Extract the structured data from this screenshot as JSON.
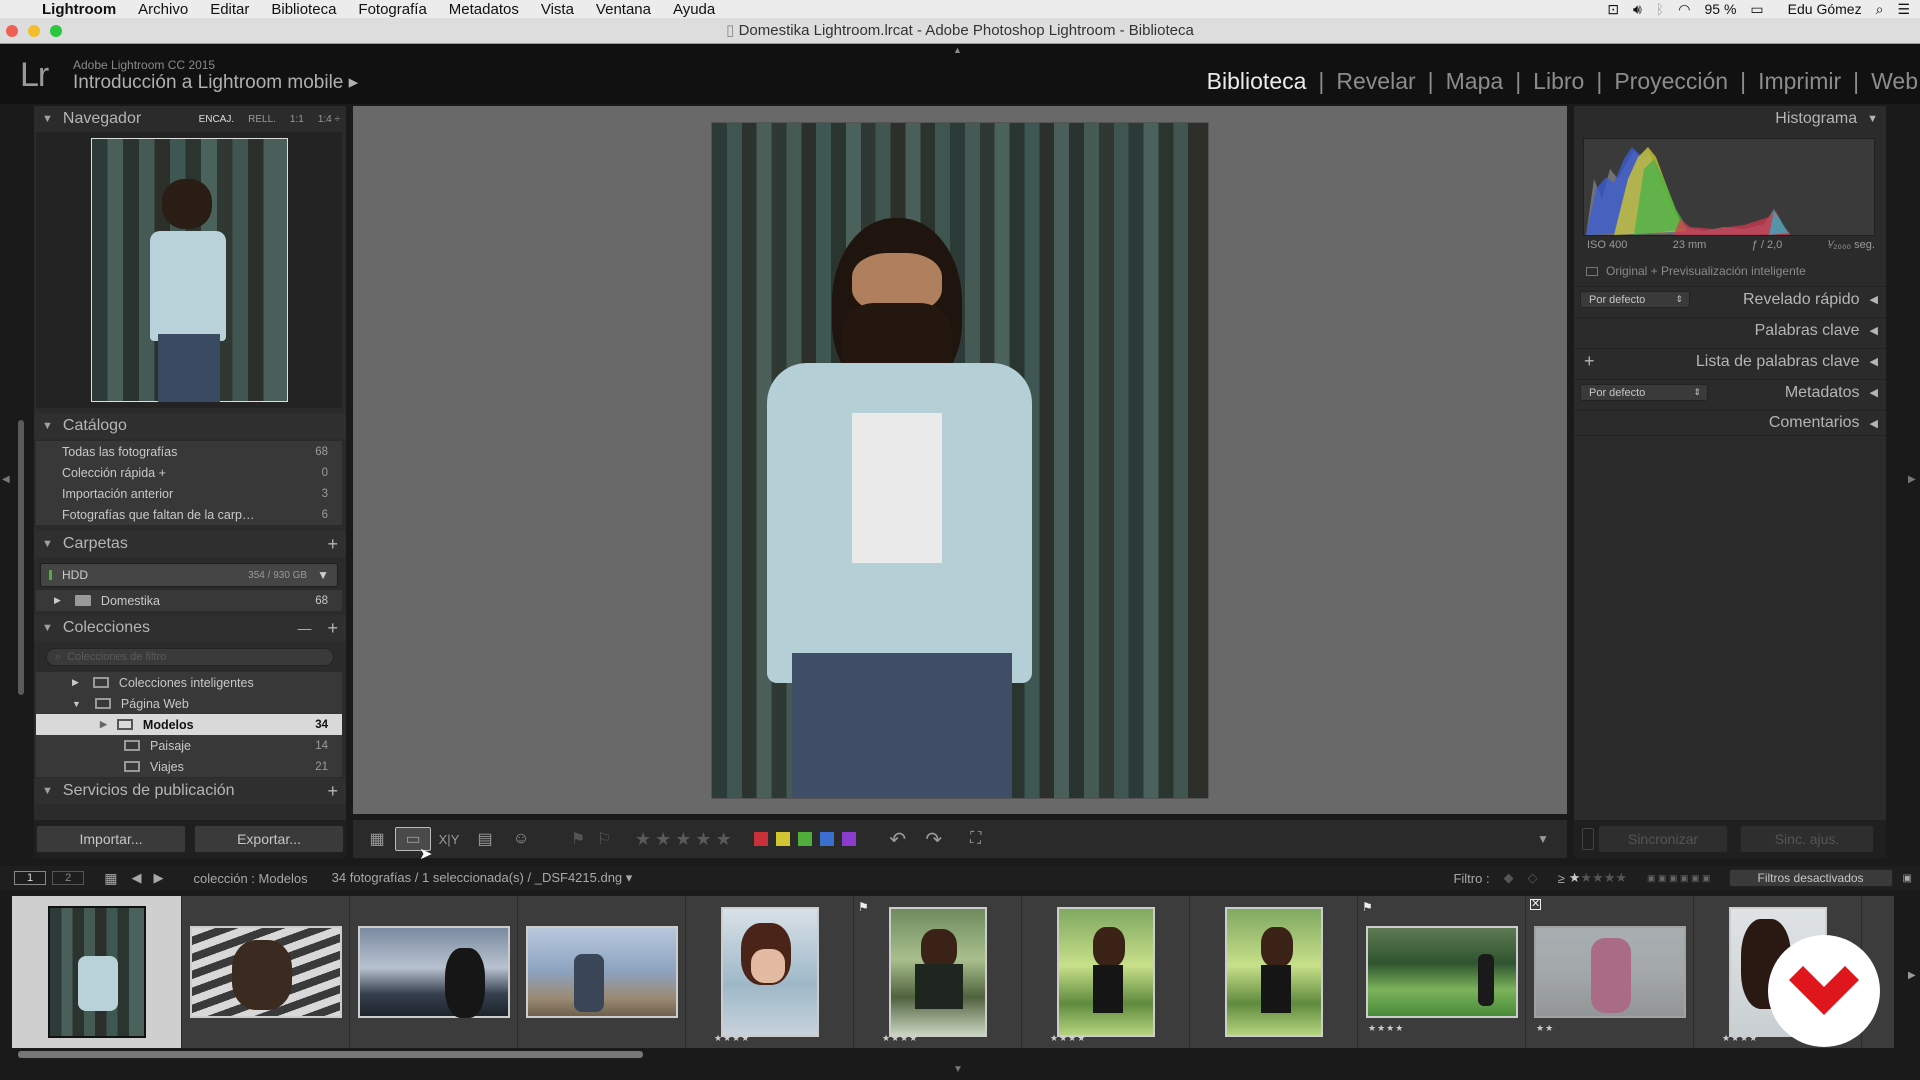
{
  "menubar": {
    "apple": "",
    "items": [
      "Lightroom",
      "Archivo",
      "Editar",
      "Biblioteca",
      "Fotografía",
      "Metadatos",
      "Vista",
      "Ventana",
      "Ayuda"
    ],
    "battery": "95 %",
    "user": "Edu Gómez"
  },
  "window": {
    "title": "Domestika Lightroom.lrcat - Adobe Photoshop Lightroom - Biblioteca"
  },
  "identity": {
    "logo": "Lr",
    "product": "Adobe Lightroom CC 2015",
    "course": "Introducción a Lightroom mobile ▸"
  },
  "modules": [
    "Biblioteca",
    "Revelar",
    "Mapa",
    "Libro",
    "Proyección",
    "Imprimir",
    "Web"
  ],
  "navigator": {
    "title": "Navegador",
    "zoom": [
      "ENCAJ.",
      "RELL.",
      "1:1",
      "1:4 ÷"
    ]
  },
  "catalog": {
    "title": "Catálogo",
    "items": [
      {
        "label": "Todas las fotografías",
        "count": "68"
      },
      {
        "label": "Colección rápida +",
        "count": "0"
      },
      {
        "label": "Importación anterior",
        "count": "3"
      },
      {
        "label": "Fotografías que faltan de la carp…",
        "count": "6"
      }
    ]
  },
  "folders": {
    "title": "Carpetas",
    "add": "+",
    "volume": {
      "label": "HDD",
      "space": "354 / 930 GB"
    },
    "items": [
      {
        "label": "Domestika",
        "count": "68"
      }
    ]
  },
  "collections": {
    "title": "Colecciones",
    "minus": "—",
    "add": "+",
    "search_placeholder": "Colecciones de filtro",
    "items": [
      {
        "label": "Colecciones inteligentes",
        "count": ""
      },
      {
        "label": "Página Web",
        "count": ""
      },
      {
        "label": "Modelos",
        "count": "34"
      },
      {
        "label": "Paisaje",
        "count": "14"
      },
      {
        "label": "Viajes",
        "count": "21"
      }
    ]
  },
  "publish": {
    "title": "Servicios de publicación",
    "add": "+"
  },
  "bottom_buttons": {
    "import": "Importar...",
    "export": "Exportar..."
  },
  "right": {
    "histogram_title": "Histograma",
    "exif": {
      "iso": "ISO 400",
      "focal": "23 mm",
      "aperture": "ƒ / 2,0",
      "shutter": "¹⁄₂₀₀₀ seg."
    },
    "preview": "Original + Previsualización inteligente",
    "panels": [
      {
        "label": "Revelado rápido",
        "preset": "Por defecto"
      },
      {
        "label": "Palabras clave",
        "preset": ""
      },
      {
        "label": "Lista de palabras clave",
        "preset": "+"
      },
      {
        "label": "Metadatos",
        "preset": "Por defecto"
      },
      {
        "label": "Comentarios",
        "preset": ""
      }
    ],
    "sync": "Sincronizar",
    "sync_settings": "Sinc. ajus."
  },
  "filmstrip": {
    "screens": [
      "1",
      "2"
    ],
    "source": "colección : Modelos",
    "info": "34 fotografías / 1 seleccionada(s) / _DSF4215.dng ▾",
    "filter_label": "Filtro :",
    "filter_value": "Filtros desactivados",
    "thumb_stars": [
      "",
      "",
      "",
      "",
      "★★★★",
      "★★★★",
      "★★★★",
      "",
      "★★★★",
      "★★",
      "★★★★"
    ]
  },
  "colors": {
    "panel_bg": "#2b2b2b",
    "center_bg": "#696969",
    "label_red": "#c8313a",
    "label_yellow": "#d4c532",
    "label_green": "#4fae3b",
    "label_blue": "#3a6fd0",
    "label_purple": "#8a3ccf",
    "brand": "#e0161d"
  }
}
